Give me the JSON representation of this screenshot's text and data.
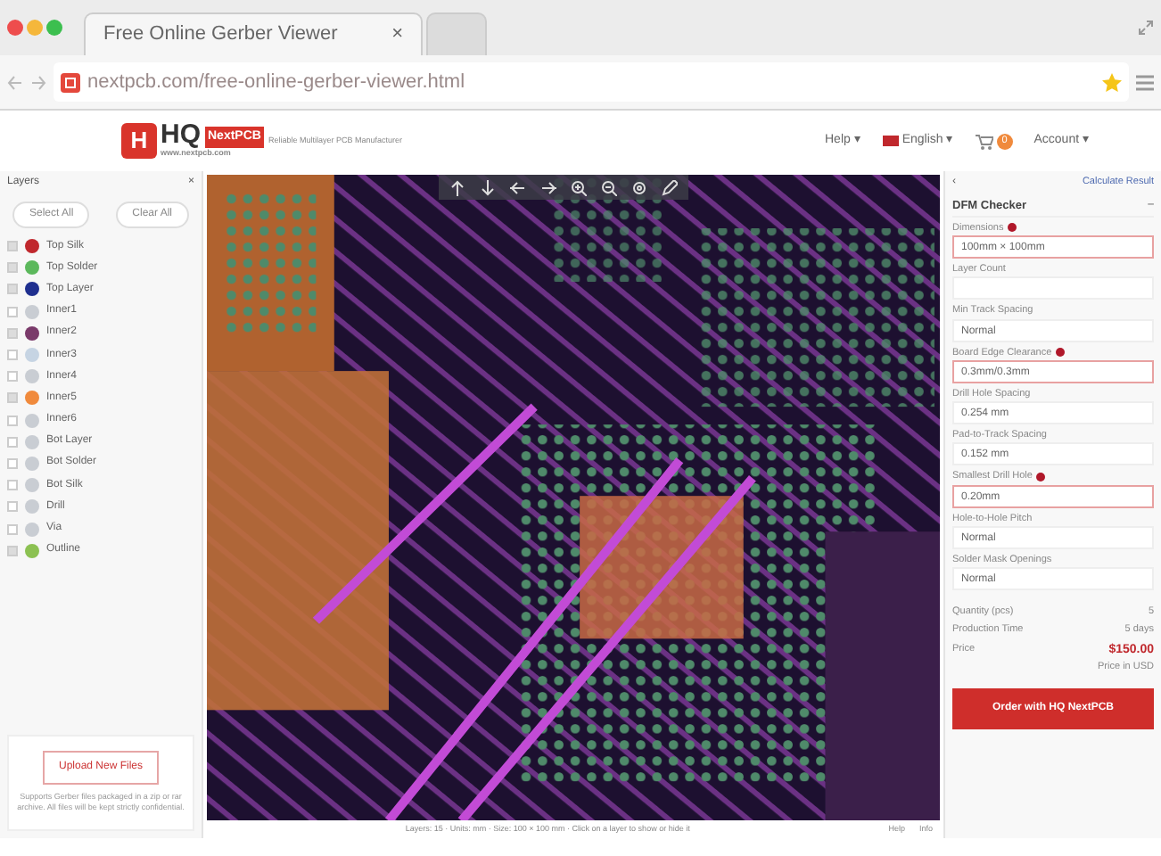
{
  "browser": {
    "tabs": [
      {
        "title": "Free Online Gerber Viewer",
        "close": "×",
        "selected": true
      },
      {
        "selected": false
      }
    ],
    "url": "nextpcb.com/free-online-gerber-viewer.html"
  },
  "header": {
    "logo_mark": "H",
    "logo_text": "HQ",
    "logo_badge": "NextPCB",
    "tagline": "Reliable Multilayer PCB Manufacturer",
    "site": "www.nextpcb.com",
    "nav": [
      {
        "kind": "menu",
        "label": "Help ▾"
      },
      {
        "kind": "language",
        "label": "English ▾"
      },
      {
        "kind": "cart",
        "label": "0"
      },
      {
        "kind": "menu",
        "label": "Account ▾"
      }
    ]
  },
  "layers": {
    "title": "Layers",
    "close": "×",
    "buttons": [
      "Select All",
      "Clear All"
    ],
    "items": [
      {
        "name": "Top Silk",
        "checked": true,
        "color": "#c0282d"
      },
      {
        "name": "Top Solder",
        "checked": true,
        "color": "#5cb85c"
      },
      {
        "name": "Top Layer",
        "checked": true,
        "color": "#1f2f8f"
      },
      {
        "name": "Inner1",
        "checked": false,
        "color": "#c9cdd3"
      },
      {
        "name": "Inner2",
        "checked": true,
        "color": "#7a3a6a"
      },
      {
        "name": "Inner3",
        "checked": false,
        "color": "#c6d4e3"
      },
      {
        "name": "Inner4",
        "checked": false,
        "color": "#c9cdd3"
      },
      {
        "name": "Inner5",
        "checked": true,
        "color": "#f08a3c"
      },
      {
        "name": "Inner6",
        "checked": false,
        "color": "#c9cdd3"
      },
      {
        "name": "Bot Layer",
        "checked": false,
        "color": "#c9cdd3"
      },
      {
        "name": "Bot Solder",
        "checked": false,
        "color": "#c9cdd3"
      },
      {
        "name": "Bot Silk",
        "checked": false,
        "color": "#c9cdd3"
      },
      {
        "name": "Drill",
        "checked": false,
        "color": "#c9cdd3"
      },
      {
        "name": "Via",
        "checked": false,
        "color": "#c9cdd3"
      },
      {
        "name": "Outline",
        "checked": true,
        "color": "#8cc152"
      }
    ],
    "upload_button": "Upload New Files",
    "hint": "Supports Gerber files packaged in a zip or rar archive. All files will be kept strictly confidential."
  },
  "toolbar": [
    {
      "kind": "up"
    },
    {
      "kind": "down"
    },
    {
      "kind": "left"
    },
    {
      "kind": "right"
    },
    {
      "kind": "zoom-in"
    },
    {
      "kind": "zoom-out"
    },
    {
      "kind": "fit"
    },
    {
      "kind": "pen"
    }
  ],
  "status_bar": {
    "text": "Layers: 15 · Units: mm · Size: 100 × 100 mm · Click on a layer to show or hide it",
    "links": [
      "Help",
      "Info"
    ]
  },
  "dfm": {
    "back": "‹",
    "result_link": "Calculate Result",
    "title": "DFM Checker",
    "collapse": "–",
    "fields": [
      {
        "label": "Dimensions",
        "required": true,
        "value": "100mm × 100mm"
      },
      {
        "label": "Layer Count",
        "required": false
      },
      {
        "label": "Min Track Spacing",
        "required": false,
        "value": "Normal"
      },
      {
        "label": "Board Edge Clearance",
        "required": true,
        "value": "0.3mm/0.3mm"
      },
      {
        "label": "Drill Hole Spacing",
        "required": false,
        "value": "0.254 mm"
      },
      {
        "label": "Pad-to-Track Spacing",
        "required": false,
        "value": "0.152 mm"
      },
      {
        "label": "Smallest Drill Hole",
        "required": true,
        "value": "0.20mm"
      },
      {
        "label": "Hole-to-Hole Pitch",
        "required": false,
        "value": "Normal"
      },
      {
        "label": "Solder Mask Openings",
        "required": false,
        "value": "Normal"
      }
    ],
    "summary": [
      {
        "label": "Quantity (pcs)",
        "value": "5"
      },
      {
        "label": "Production Time",
        "value": "5 days"
      },
      {
        "label": "Price",
        "value": "$150.00"
      }
    ],
    "price_note": "Price in USD",
    "order_button": "Order with HQ NextPCB"
  }
}
